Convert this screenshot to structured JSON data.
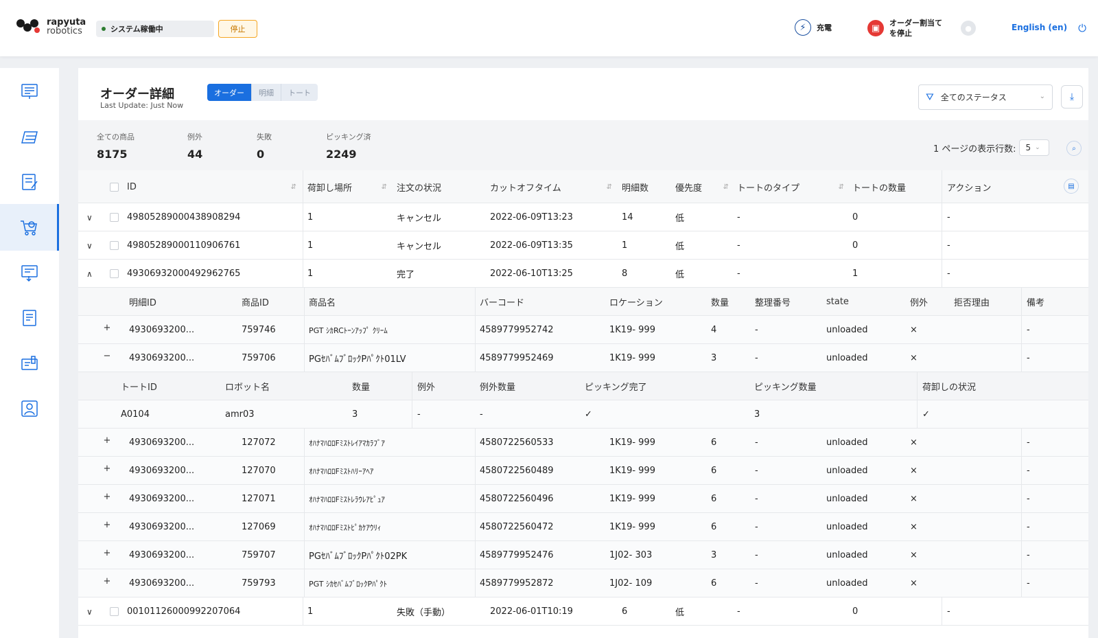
{
  "brand": {
    "line1": "rapyuta",
    "line2": "robotics"
  },
  "topbar": {
    "system_status": "システム稼働中",
    "stop_label": "停止",
    "charge_label": "充電",
    "stop_assign_label_1": "オーダー割当て",
    "stop_assign_label_2": "を停止",
    "language": "English (en)"
  },
  "page": {
    "title": "オーダー詳細",
    "last_update": "Last Update: Just Now",
    "tabs": [
      "オーダー",
      "明細",
      "トート"
    ],
    "status_filter": "全てのステータス"
  },
  "summary": {
    "total_label": "全ての商品",
    "total_value": "8175",
    "exception_label": "例外",
    "exception_value": "44",
    "failed_label": "失敗",
    "failed_value": "0",
    "picked_label": "ピッキング済",
    "picked_value": "2249",
    "rows_per_page_label": "1 ページの表示行数:",
    "rows_per_page_value": "5"
  },
  "orders": {
    "headers": [
      "ID",
      "荷卸し場所",
      "注文の状況",
      "カットオフタイム",
      "明細数",
      "優先度",
      "トートのタイプ",
      "トートの数量",
      "アクション"
    ],
    "rows": [
      {
        "id": "49805289000438908294",
        "dock": "1",
        "status": "キャンセル",
        "cutoff": "2022-06-09T13:23",
        "lines": "14",
        "priority": "低",
        "tote_type": "-",
        "tote_qty": "0",
        "action": "-"
      },
      {
        "id": "4980528900011​0906761",
        "dock": "1",
        "status": "キャンセル",
        "cutoff": "2022-06-09T13:35",
        "lines": "1",
        "priority": "低",
        "tote_type": "-",
        "tote_qty": "0",
        "action": "-"
      },
      {
        "id": "49306932000492962765",
        "dock": "1",
        "status": "完了",
        "cutoff": "2022-06-10T13:25",
        "lines": "8",
        "priority": "低",
        "tote_type": "-",
        "tote_qty": "1",
        "action": "-"
      },
      {
        "id": "00101126000992207064",
        "dock": "1",
        "status": "失敗（手動）",
        "cutoff": "2022-06-01T10:19",
        "lines": "6",
        "priority": "低",
        "tote_type": "-",
        "tote_qty": "0",
        "action": "-"
      }
    ]
  },
  "lines": {
    "headers": [
      "明細ID",
      "商品ID",
      "商品名",
      "バーコード",
      "ロケーション",
      "数量",
      "整理番号",
      "state",
      "例外",
      "拒否理由",
      "備考"
    ],
    "rows": [
      {
        "line_id": "4930693200...",
        "sku": "759746",
        "name": "PGT ｼｶRCﾄｰﾝｱｯﾌﾟ ｸﾘｰﾑ",
        "barcode": "4589779952742",
        "location": "1K19- 999",
        "qty": "4",
        "ref": "-",
        "state": "unloaded",
        "exc": "×",
        "reason": "",
        "note": "-"
      },
      {
        "line_id": "4930693200...",
        "sku": "759706",
        "name": "PGｾﾊﾞﾑﾌﾞﾛｯｸPﾊﾟｸﾄ01LV",
        "barcode": "4589779952469",
        "location": "1K19- 999",
        "qty": "3",
        "ref": "-",
        "state": "unloaded",
        "exc": "×",
        "reason": "",
        "note": "-"
      },
      {
        "line_id": "4930693200...",
        "sku": "127072",
        "name": "ｵﾊﾅﾏﾊﾛﾛFﾐｽﾄﾚｲｱﾏｶﾗﾌﾞｱ",
        "barcode": "4580722560533",
        "location": "1K19- 999",
        "qty": "6",
        "ref": "-",
        "state": "unloaded",
        "exc": "×",
        "reason": "",
        "note": "-"
      },
      {
        "line_id": "4930693200...",
        "sku": "127070",
        "name": "ｵﾊﾅﾏﾊﾛﾛFﾐｽﾄﾊﾘｰｱﾍｱ",
        "barcode": "4580722560489",
        "location": "1K19- 999",
        "qty": "6",
        "ref": "-",
        "state": "unloaded",
        "exc": "×",
        "reason": "",
        "note": "-"
      },
      {
        "line_id": "4930693200...",
        "sku": "127071",
        "name": "ｵﾊﾅﾏﾊﾛﾛFﾐｽﾄﾚﾗｳﾚｱﾋﾟｭｱ",
        "barcode": "4580722560496",
        "location": "1K19- 999",
        "qty": "6",
        "ref": "-",
        "state": "unloaded",
        "exc": "×",
        "reason": "",
        "note": "-"
      },
      {
        "line_id": "4930693200...",
        "sku": "127069",
        "name": "ｵﾊﾅﾏﾊﾛﾛFﾐｽﾄﾋﾟｶｹｱｳﾘｨ",
        "barcode": "4580722560472",
        "location": "1K19- 999",
        "qty": "6",
        "ref": "-",
        "state": "unloaded",
        "exc": "×",
        "reason": "",
        "note": "-"
      },
      {
        "line_id": "4930693200...",
        "sku": "759707",
        "name": "PGｾﾊﾞﾑﾌﾞﾛｯｸPﾊﾟｸﾄ02PK",
        "barcode": "4589779952476",
        "location": "1J02- 303",
        "qty": "3",
        "ref": "-",
        "state": "unloaded",
        "exc": "×",
        "reason": "",
        "note": "-"
      },
      {
        "line_id": "4930693200...",
        "sku": "759793",
        "name": "PGT ｼｶｾﾊﾞﾑﾌﾞﾛｯｸPﾊﾟｸﾄ",
        "barcode": "4589779952872",
        "location": "1J02- 109",
        "qty": "6",
        "ref": "-",
        "state": "unloaded",
        "exc": "×",
        "reason": "",
        "note": "-"
      }
    ]
  },
  "totes": {
    "headers": [
      "トートID",
      "ロボット名",
      "数量",
      "例外",
      "例外数量",
      "ピッキング完了",
      "ピッキング数量",
      "荷卸しの状況"
    ],
    "rows": [
      {
        "tote_id": "A0104",
        "robot": "amr03",
        "qty": "3",
        "exc": "-",
        "exc_qty": "-",
        "picked": "✓",
        "pick_qty": "3",
        "unload": "✓"
      }
    ]
  },
  "colors": {
    "accent": "#1a6fe0",
    "warning": "#f5a623",
    "danger": "#e53935",
    "ok": "#2e7d32"
  }
}
